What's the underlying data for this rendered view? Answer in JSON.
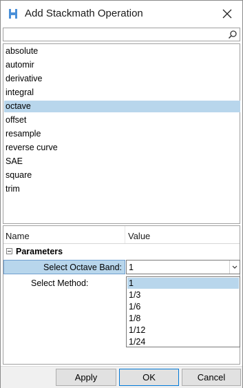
{
  "window": {
    "title": "Add Stackmath Operation",
    "app_icon": "altair-hyperworks-icon",
    "close_icon": "close-icon"
  },
  "search": {
    "value": "",
    "placeholder": "",
    "icon": "search-icon"
  },
  "operations": {
    "items": [
      "absolute",
      "automir",
      "derivative",
      "integral",
      "octave",
      "offset",
      "resample",
      "reverse curve",
      "SAE",
      "square",
      "trim"
    ],
    "selected": "octave"
  },
  "property_grid": {
    "headers": {
      "name": "Name",
      "value": "Value"
    },
    "group": "Parameters",
    "properties": [
      {
        "label": "Select Octave Band:",
        "value": "1"
      },
      {
        "label": "Select Method:",
        "value": ""
      }
    ],
    "dropdown_options": [
      "1",
      "1/3",
      "1/6",
      "1/8",
      "1/12",
      "1/24"
    ],
    "dropdown_selected": "1"
  },
  "buttons": {
    "apply": "Apply",
    "ok": "OK",
    "cancel": "Cancel"
  },
  "colors": {
    "selection": "#b8d6ec",
    "focus_border": "#0078d7",
    "button_bg": "#e1e1e1"
  }
}
